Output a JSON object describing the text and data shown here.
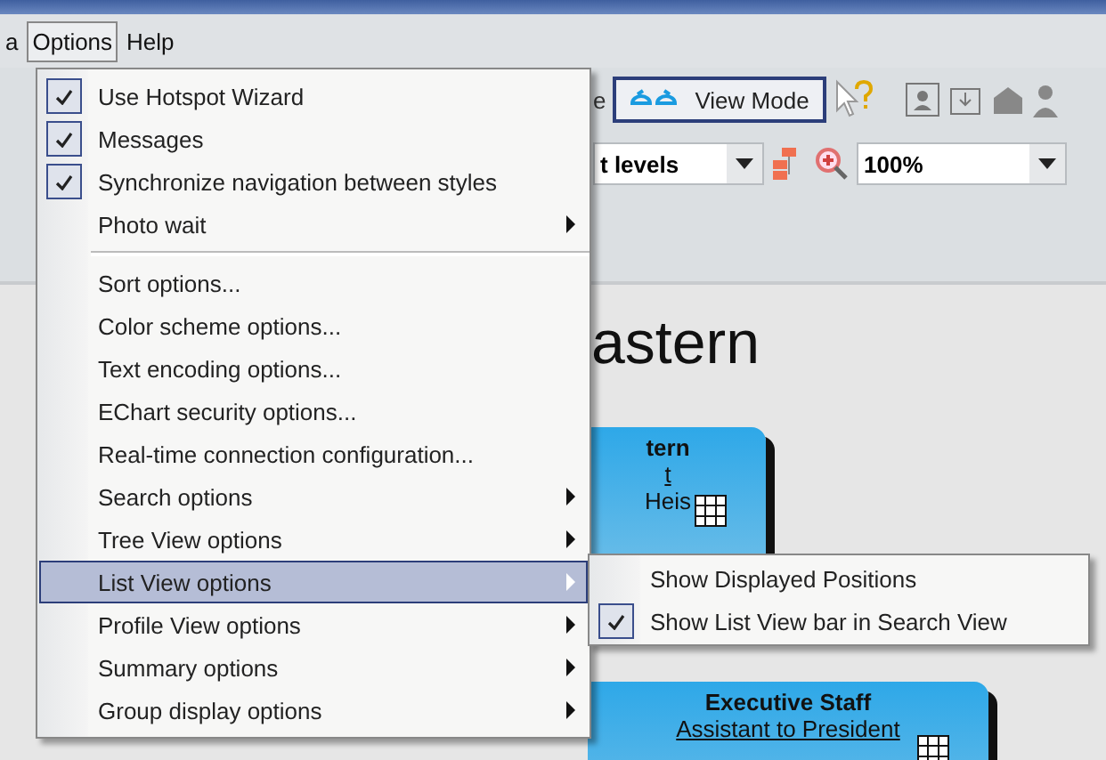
{
  "menubar": [
    {
      "label": "a",
      "selected": false
    },
    {
      "label": "Options",
      "selected": true
    },
    {
      "label": "Help",
      "selected": false
    }
  ],
  "toolbar": {
    "partial_label": "e",
    "view_mode_button": "View Mode",
    "levels_dropdown": "t levels",
    "zoom_dropdown": "100%"
  },
  "canvas": {
    "title": "astern",
    "cards": [
      {
        "title": "tern",
        "link": "t",
        "name": "Heis"
      },
      {
        "title": "Executive Staff",
        "link": "Assistant to President"
      }
    ]
  },
  "options_menu": [
    {
      "kind": "item",
      "label": "Use Hotspot Wizard",
      "checked": true,
      "submenu": false,
      "selected": false
    },
    {
      "kind": "item",
      "label": "Messages",
      "checked": true,
      "submenu": false,
      "selected": false
    },
    {
      "kind": "item",
      "label": "Synchronize navigation between styles",
      "checked": true,
      "submenu": false,
      "selected": false
    },
    {
      "kind": "item",
      "label": "Photo wait",
      "checked": false,
      "submenu": true,
      "selected": false
    },
    {
      "kind": "separator"
    },
    {
      "kind": "item",
      "label": "Sort options...",
      "checked": false,
      "submenu": false,
      "selected": false
    },
    {
      "kind": "item",
      "label": "Color scheme options...",
      "checked": false,
      "submenu": false,
      "selected": false
    },
    {
      "kind": "item",
      "label": "Text encoding options...",
      "checked": false,
      "submenu": false,
      "selected": false
    },
    {
      "kind": "item",
      "label": "EChart security options...",
      "checked": false,
      "submenu": false,
      "selected": false
    },
    {
      "kind": "item",
      "label": "Real-time connection configuration...",
      "checked": false,
      "submenu": false,
      "selected": false
    },
    {
      "kind": "item",
      "label": "Search options",
      "checked": false,
      "submenu": true,
      "selected": false
    },
    {
      "kind": "item",
      "label": "Tree View options",
      "checked": false,
      "submenu": true,
      "selected": false
    },
    {
      "kind": "item",
      "label": "List View options",
      "checked": false,
      "submenu": true,
      "selected": true
    },
    {
      "kind": "item",
      "label": "Profile View options",
      "checked": false,
      "submenu": true,
      "selected": false
    },
    {
      "kind": "item",
      "label": "Summary options",
      "checked": false,
      "submenu": true,
      "selected": false
    },
    {
      "kind": "item",
      "label": "Group display options",
      "checked": false,
      "submenu": true,
      "selected": false
    }
  ],
  "list_view_submenu": [
    {
      "label": "Show Displayed Positions",
      "checked": false
    },
    {
      "label": "Show List View bar in Search View",
      "checked": true
    }
  ]
}
